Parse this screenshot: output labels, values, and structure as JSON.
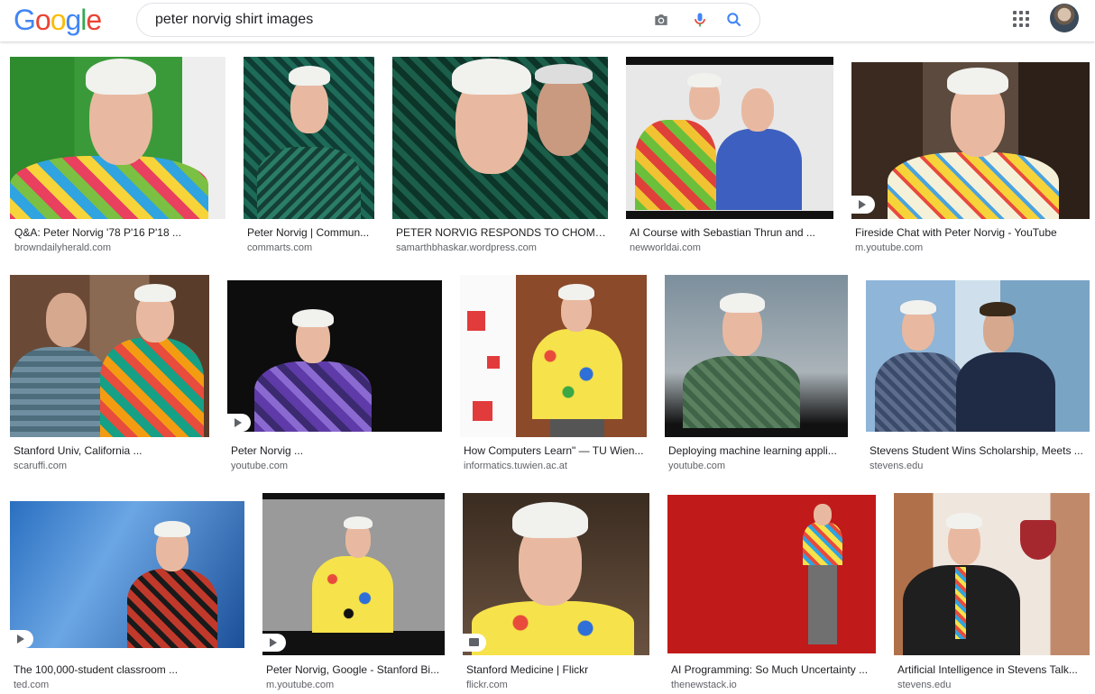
{
  "search": {
    "query": "peter norvig shirt images"
  },
  "logo": {
    "letters": [
      "G",
      "o",
      "o",
      "g",
      "l",
      "e"
    ]
  },
  "results": [
    {
      "caption": "Q&A: Peter Norvig '78 P'16 P'18 ...",
      "source": "browndailyherald.com"
    },
    {
      "caption": "Peter Norvig | Commun...",
      "source": "commarts.com"
    },
    {
      "caption": "PETER NORVIG RESPONDS TO CHOMSK...",
      "source": "samarthbhaskar.wordpress.com"
    },
    {
      "caption": "AI Course with Sebastian Thrun and ...",
      "source": "newworldai.com"
    },
    {
      "caption": "Fireside Chat with Peter Norvig - YouTube",
      "source": "m.youtube.com"
    },
    {
      "caption": "Stanford Univ, California ...",
      "source": "scaruffi.com"
    },
    {
      "caption": "Peter Norvig ...",
      "source": "youtube.com"
    },
    {
      "caption": "How Computers Learn\" — TU Wien...",
      "source": "informatics.tuwien.ac.at"
    },
    {
      "caption": "Deploying machine learning appli...",
      "source": "youtube.com"
    },
    {
      "caption": "Stevens Student Wins Scholarship, Meets ...",
      "source": "stevens.edu"
    },
    {
      "caption": "The 100,000-student classroom ...",
      "source": "ted.com"
    },
    {
      "caption": "Peter Norvig, Google - Stanford Bi...",
      "source": "m.youtube.com"
    },
    {
      "caption": "Stanford Medicine | Flickr",
      "source": "flickr.com"
    },
    {
      "caption": "AI Programming: So Much Uncertainty ...",
      "source": "thenewstack.io"
    },
    {
      "caption": "Artificial Intelligence in Stevens Talk...",
      "source": "stevens.edu"
    }
  ]
}
